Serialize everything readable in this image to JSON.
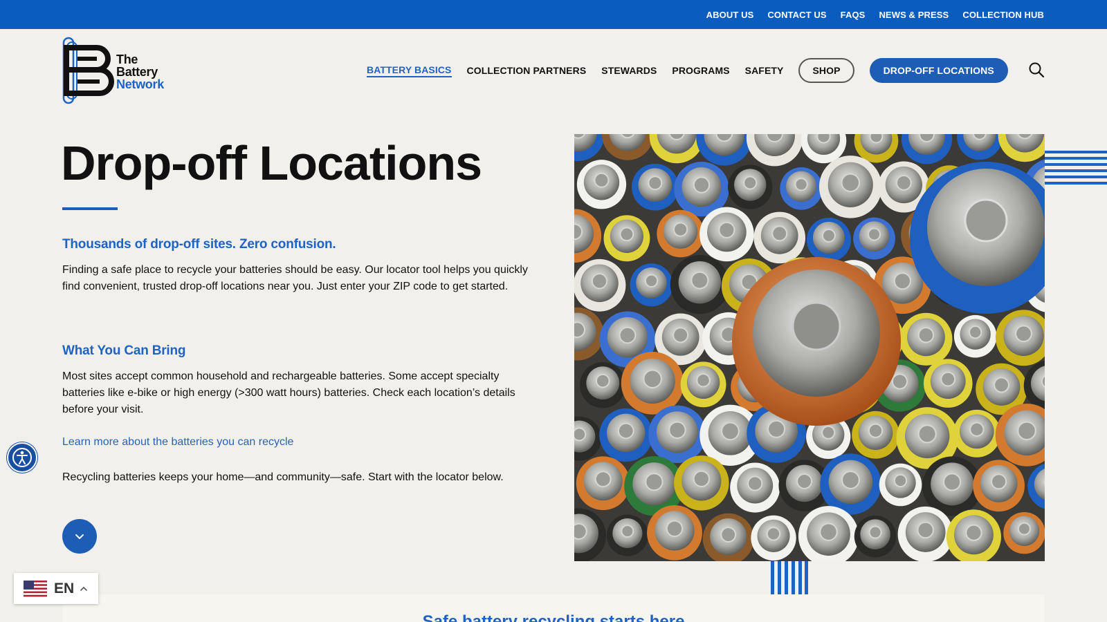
{
  "topbar": {
    "links": [
      "ABOUT US",
      "CONTACT US",
      "FAQS",
      "NEWS & PRESS",
      "COLLECTION HUB"
    ]
  },
  "header": {
    "logo": {
      "line1": "The",
      "line2": "Battery",
      "line3": "Network"
    },
    "nav": [
      "BATTERY BASICS",
      "COLLECTION PARTNERS",
      "STEWARDS",
      "PROGRAMS",
      "SAFETY"
    ],
    "shop_label": "SHOP",
    "dropoff_label": "DROP-OFF LOCATIONS",
    "search_icon": "search-icon"
  },
  "main": {
    "title": "Drop-off Locations",
    "section1": {
      "heading": "Thousands of drop-off sites. Zero confusion.",
      "body": "Finding a safe place to recycle your batteries should be easy. Our locator tool helps you quickly find convenient, trusted drop-off locations near you. Just enter your ZIP code to get started."
    },
    "section2": {
      "heading": "What You Can Bring",
      "body": "Most sites accept common household and rechargeable batteries. Some accept specialty batteries like e-bike or high energy (>300 watt hours) batteries. Check each location’s details before your visit."
    },
    "learn_link": "Learn more about the batteries you can recycle",
    "closing": "Recycling batteries keeps your home—and community—safe. Start with the locator below."
  },
  "bottom": {
    "heading": "Safe battery recycling starts here"
  },
  "language": {
    "code": "EN"
  },
  "colors": {
    "brand_blue": "#0a5cbf",
    "accent_blue": "#1e5db5",
    "background": "#f1f0ec"
  }
}
